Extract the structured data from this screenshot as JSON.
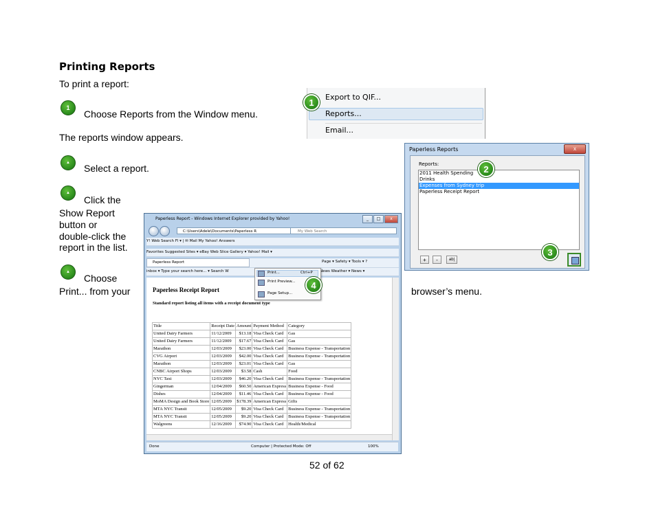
{
  "heading": "Printing Reports",
  "intro": "To print a report:",
  "steps": {
    "step1_text": "Choose Reports from the Window menu.",
    "after1": "The reports window appears.",
    "step2_text": "Select a report.",
    "step3_line1": "Click the",
    "step3_line2": "Show Report",
    "step3_line3": "button or",
    "step3_line4": "double-click the",
    "step3_line5": "report in the list.",
    "step4_line1": "Choose",
    "step4_line2": "Print... from your",
    "step4_tail": "browser’s menu.",
    "badge1": "1",
    "badge_small": "▲"
  },
  "callouts": [
    "1",
    "2",
    "3",
    "4"
  ],
  "window_menu": {
    "items": [
      "Export to QIF...",
      "Reports...",
      "Email..."
    ]
  },
  "reports_dialog": {
    "title": "Paperless Reports",
    "close": "x",
    "label": "Reports:",
    "items": [
      "2011 Health Spending",
      "Drinks",
      "Expenses from Sydney trip",
      "Paperless Receipt Report"
    ],
    "selected_index": 2,
    "buttons": [
      "+",
      "-",
      "ab|"
    ]
  },
  "browser": {
    "title": "Paperless Report - Windows Internet Explorer provided by Yahoo!",
    "address": "C:\\Users\\Adele\\Documents\\Paperless R",
    "search_placeholder": "My Web Search",
    "yahoo_bar": "Y!   Web Search  Fl ▾  |  ✉ Mail  My Yahoo!  Answers",
    "fav_bar": "Favorites   Suggested Sites ▾   eBay   Web Slice Gallery ▾   Yahoo! Mail ▾",
    "tab_label": "Paperless Report",
    "cmd_bar": "Page ▾   Safety ▾   Tools ▾   ?",
    "link_bar": "inbox ▾  Type your search here...  ▾  Search W",
    "link_bar2": "News   Weather ▾   News ▾",
    "menu": {
      "items": [
        "Print...",
        "Print Preview...",
        "Page Setup..."
      ],
      "shortcut": "Ctrl+P"
    },
    "report_title": "Paperless Receipt Report",
    "report_subtitle": "Standard report listing all items with a receipt document type",
    "columns": [
      "Title",
      "Receipt Date",
      "Amount",
      "Payment Method",
      "Category"
    ],
    "rows": [
      [
        "United Dairy Farmers",
        "11/12/2009",
        "$13.18",
        "Visa Check Card",
        "Gas"
      ],
      [
        "United Dairy Farmers",
        "11/12/2009",
        "$17.67",
        "Visa Check Card",
        "Gas"
      ],
      [
        "Marathon",
        "12/03/2009",
        "$23.00",
        "Visa Check Card",
        "Business Expense - Transportation"
      ],
      [
        "CVG Airport",
        "12/03/2009",
        "$42.00",
        "Visa Check Card",
        "Business Expense - Transportation"
      ],
      [
        "Marathon",
        "12/03/2009",
        "$23.01",
        "Visa Check Card",
        "Gas"
      ],
      [
        "CNBC Airport Shops",
        "12/03/2009",
        "$3.58",
        "Cash",
        "Food"
      ],
      [
        "NYC Taxi",
        "12/03/2009",
        "$46.20",
        "Visa Check Card",
        "Business Expense - Transportation"
      ],
      [
        "Gingerman",
        "12/04/2009",
        "$60.50",
        "American Express",
        "Business Expense - Food"
      ],
      [
        "Dishes",
        "12/04/2009",
        "$11.46",
        "Visa Check Card",
        "Business Expense - Food"
      ],
      [
        "MoMA Design and Book Store",
        "12/05/2009",
        "$178.39",
        "American Express",
        "Gifts"
      ],
      [
        "MTA NYC Transit",
        "12/05/2009",
        "$9.20",
        "Visa Check Card",
        "Business Expense - Transportation"
      ],
      [
        "MTA NYC Transit",
        "12/05/2009",
        "$9.20",
        "Visa Check Card",
        "Business Expense - Transportation"
      ],
      [
        "Walgreens",
        "12/16/2009",
        "$74.90",
        "Visa Check Card",
        "Health/Medical"
      ]
    ],
    "status_left": "Done",
    "status_mid": "Computer | Protected Mode: Off",
    "status_zoom": "100%"
  },
  "page_number": "52 of 62"
}
